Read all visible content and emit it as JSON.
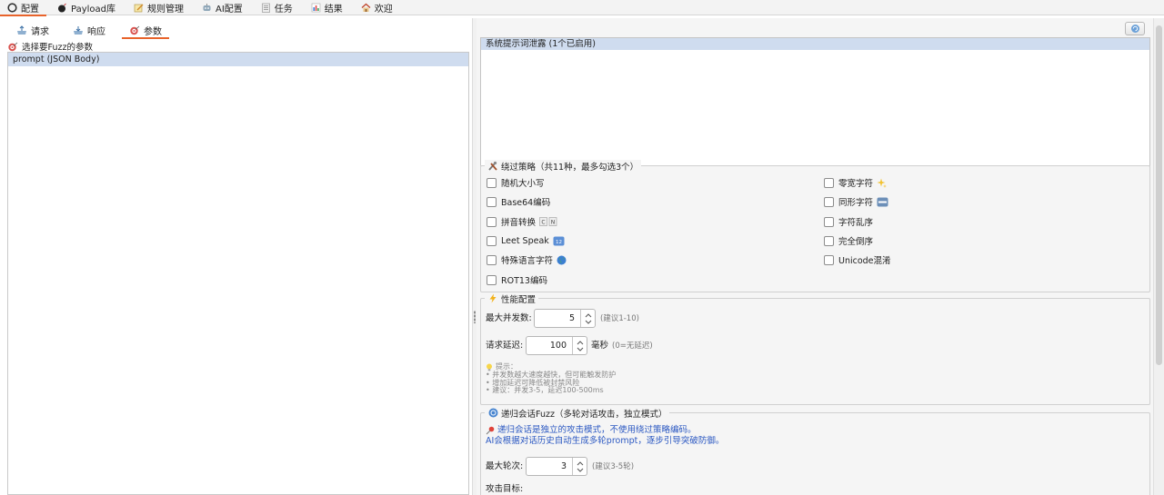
{
  "top_tabs": [
    {
      "label": "配置",
      "icon": "config-circle-icon",
      "active": true
    },
    {
      "label": "Payload库",
      "icon": "bomb-icon",
      "active": false
    },
    {
      "label": "规则管理",
      "icon": "notepad-pencil-icon",
      "active": false
    },
    {
      "label": "AI配置",
      "icon": "robot-icon",
      "active": false
    },
    {
      "label": "任务",
      "icon": "task-list-icon",
      "active": false
    },
    {
      "label": "结果",
      "icon": "bar-chart-icon",
      "active": false
    },
    {
      "label": "欢迎",
      "icon": "house-icon",
      "active": false
    }
  ],
  "sub_tabs": [
    {
      "label": "请求",
      "icon": "outbox-icon",
      "active": false
    },
    {
      "label": "响应",
      "icon": "inbox-icon",
      "active": false
    },
    {
      "label": "参数",
      "icon": "target-icon",
      "active": true
    }
  ],
  "param_panel": {
    "title": "选择要Fuzz的参数",
    "items": [
      "prompt (JSON Body)"
    ]
  },
  "prompt_list": {
    "items": [
      "系统提示词泄露 (1个已启用)"
    ]
  },
  "bypass": {
    "title": "绕过策略（共11种，最多勾选3个）",
    "left_options": [
      {
        "label": "随机大小写",
        "emoji": ""
      },
      {
        "label": "Base64编码",
        "emoji": ""
      },
      {
        "label": "拼音转换",
        "emoji": "CN"
      },
      {
        "label": "Leet Speak",
        "emoji": "1234"
      },
      {
        "label": "特殊语言字符",
        "emoji": "globe"
      },
      {
        "label": "ROT13编码",
        "emoji": ""
      }
    ],
    "right_options": [
      {
        "label": "零宽字符",
        "emoji": "sparkles"
      },
      {
        "label": "同形字符",
        "emoji": "abc"
      },
      {
        "label": "字符乱序",
        "emoji": ""
      },
      {
        "label": "完全倒序",
        "emoji": ""
      },
      {
        "label": "Unicode混淆",
        "emoji": ""
      }
    ]
  },
  "performance": {
    "title": "性能配置",
    "max_concurrency_label": "最大并发数:",
    "max_concurrency_value": "5",
    "max_concurrency_hint": "(建议1-10)",
    "delay_label": "请求延迟:",
    "delay_value": "100",
    "delay_unit": "毫秒",
    "delay_hint": "(0=无延迟)",
    "tips_title": "提示：",
    "tips": [
      "• 并发数越大速度越快，但可能触发防护",
      "• 增加延迟可降低被封禁风险",
      "• 建议：并发3-5，延迟100-500ms"
    ]
  },
  "recursive": {
    "title": "递归会话Fuzz（多轮对话攻击，独立模式）",
    "note_line1": "递归会话是独立的攻击模式，不使用绕过策略编码。",
    "note_line2": "AI会根据对话历史自动生成多轮prompt，逐步引导突破防御。",
    "max_rounds_label": "最大轮次:",
    "max_rounds_value": "3",
    "max_rounds_hint": "(建议3-5轮)",
    "attack_target_label": "攻击目标:"
  },
  "colors": {
    "accent": "#e8632b",
    "selection": "#cfdcef",
    "note_blue": "#2b58c2"
  }
}
